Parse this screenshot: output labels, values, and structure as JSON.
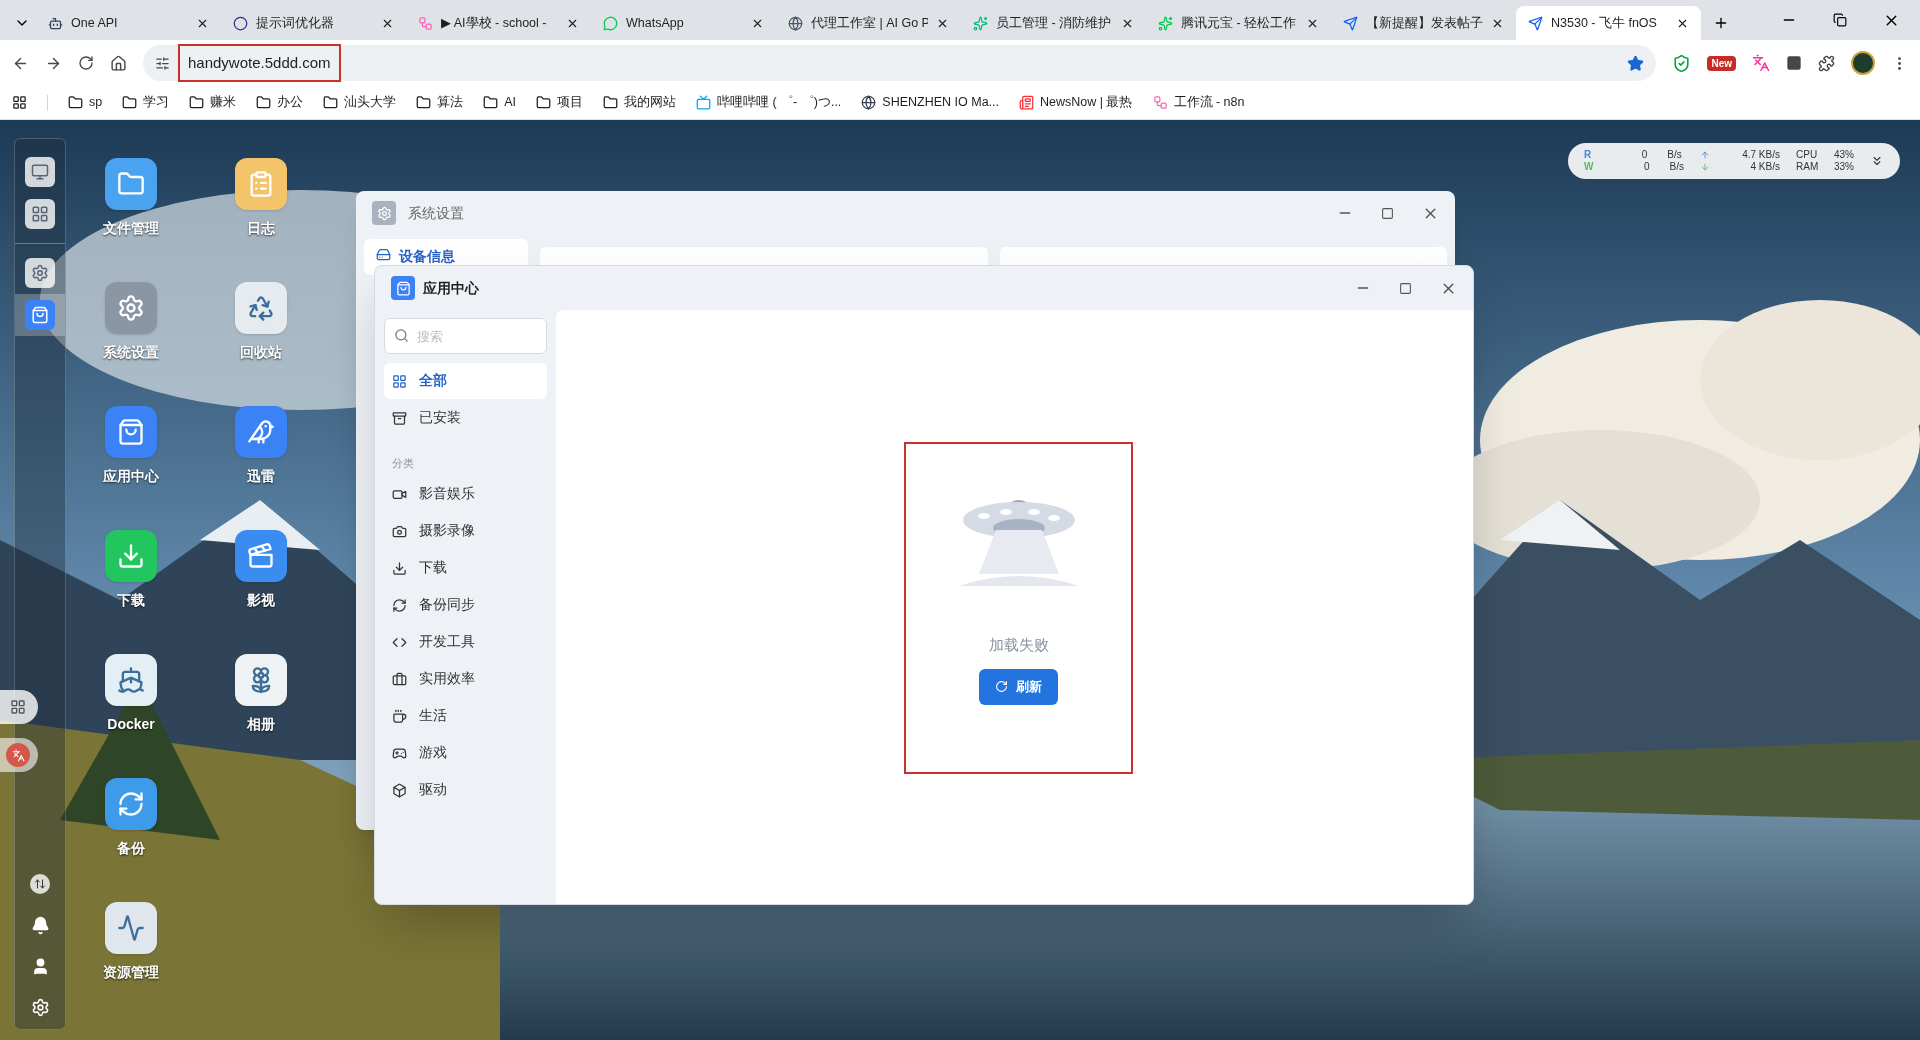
{
  "browser": {
    "tabs": [
      {
        "title": "One API",
        "selected": false
      },
      {
        "title": "提示词优化器",
        "selected": false
      },
      {
        "title": "▶ AI學校 - school -",
        "selected": false
      },
      {
        "title": "WhatsApp",
        "selected": false
      },
      {
        "title": "代理工作室 | AI Go P",
        "selected": false
      },
      {
        "title": "员工管理 - 消防维护",
        "selected": false
      },
      {
        "title": "腾讯元宝 - 轻松工作",
        "selected": false
      },
      {
        "title": "【新提醒】发表帖子",
        "selected": false
      },
      {
        "title": "N3530 - 飞牛 fnOS",
        "selected": true
      }
    ],
    "address": "handywote.5ddd.com",
    "extension_badge": "New",
    "bookmarks": [
      {
        "label": "sp",
        "kind": "folder"
      },
      {
        "label": "学习",
        "kind": "folder"
      },
      {
        "label": "赚米",
        "kind": "folder"
      },
      {
        "label": "办公",
        "kind": "folder"
      },
      {
        "label": "汕头大学",
        "kind": "folder"
      },
      {
        "label": "算法",
        "kind": "folder"
      },
      {
        "label": "AI",
        "kind": "folder"
      },
      {
        "label": "项目",
        "kind": "folder"
      },
      {
        "label": "我的网站",
        "kind": "folder"
      },
      {
        "label": "哔哩哔哩 ( ゜- ゜)つ...",
        "kind": "site"
      },
      {
        "label": "SHENZHEN IO Ma...",
        "kind": "site"
      },
      {
        "label": "NewsNow | 最热",
        "kind": "site"
      },
      {
        "label": "工作流 - n8n",
        "kind": "site"
      }
    ]
  },
  "dock": {
    "apps": [
      {
        "selected": false
      },
      {
        "selected": false
      },
      {
        "selected": false
      },
      {
        "selected": true
      }
    ]
  },
  "desktop_icons": [
    {
      "label": "文件管理"
    },
    {
      "label": "系统设置"
    },
    {
      "label": "应用中心"
    },
    {
      "label": "下载"
    },
    {
      "label": "Docker"
    },
    {
      "label": "备份"
    },
    {
      "label": "资源管理"
    },
    {
      "label": "日志"
    },
    {
      "label": "回收站"
    },
    {
      "label": "迅雷"
    },
    {
      "label": "影视"
    },
    {
      "label": "相册"
    }
  ],
  "monitor": {
    "disk": [
      {
        "label": "R",
        "rate": "0",
        "unit": "B/s"
      },
      {
        "label": "W",
        "rate": "0",
        "unit": "B/s"
      }
    ],
    "network": [
      {
        "kind": "up",
        "rate": "4.7 KB/s"
      },
      {
        "kind": "down",
        "rate": "4 KB/s"
      }
    ],
    "usage": [
      {
        "label": "CPU",
        "value": "43%"
      },
      {
        "label": "RAM",
        "value": "33%"
      }
    ]
  },
  "settings_window": {
    "title": "系统设置",
    "sidebar_item": {
      "label": "设备信息",
      "selected": true
    }
  },
  "app_center": {
    "title": "应用中心",
    "search": {
      "placeholder": "搜索"
    },
    "nav": [
      {
        "label": "全部",
        "selected": true
      },
      {
        "label": "已安装",
        "selected": false
      }
    ],
    "category_heading": "分类",
    "categories": [
      {
        "label": "影音娱乐",
        "selected": false
      },
      {
        "label": "摄影录像",
        "selected": false
      },
      {
        "label": "下载",
        "selected": false
      },
      {
        "label": "备份同步",
        "selected": false
      },
      {
        "label": "开发工具",
        "selected": false
      },
      {
        "label": "实用效率",
        "selected": false
      },
      {
        "label": "生活",
        "selected": false
      },
      {
        "label": "游戏",
        "selected": false
      },
      {
        "label": "驱动",
        "selected": false
      }
    ],
    "empty_state": {
      "message": "加载失败",
      "button": "刷新"
    }
  }
}
